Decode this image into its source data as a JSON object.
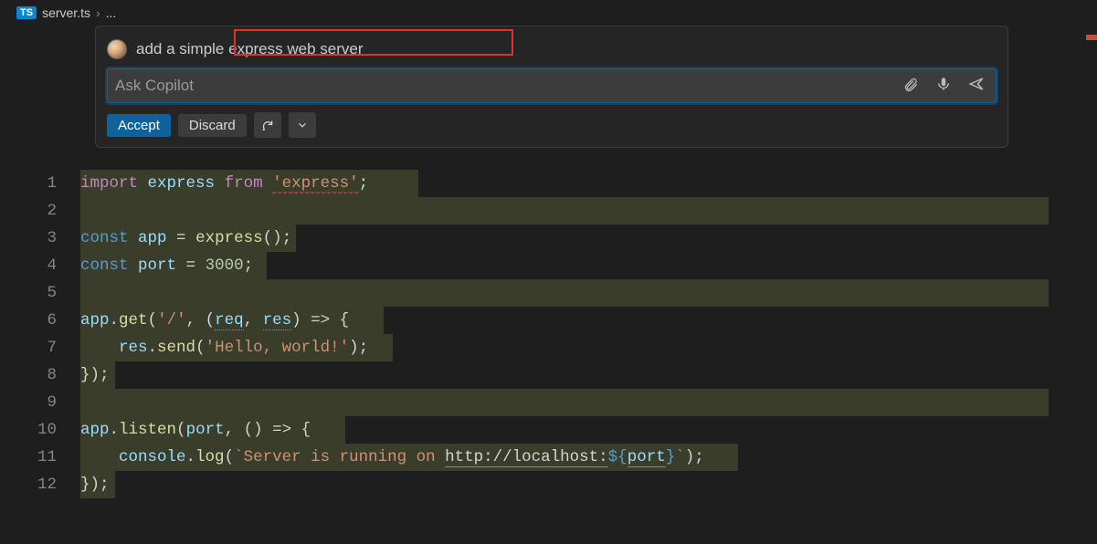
{
  "breadcrumb": {
    "badge": "TS",
    "filename": "server.ts",
    "ellipsis": "..."
  },
  "chat": {
    "prompt": "add a simple express web server",
    "placeholder": "Ask Copilot",
    "accept": "Accept",
    "discard": "Discard"
  },
  "gutter": [
    "1",
    "2",
    "3",
    "4",
    "5",
    "6",
    "7",
    "8",
    "9",
    "10",
    "11",
    "12"
  ],
  "code": {
    "l1": {
      "kw_import": "import",
      "var_express": "express",
      "kw_from": "from",
      "str_module": "'express'",
      "semi": ";"
    },
    "l3": {
      "kw_const": "const",
      "var_app": "app",
      "eq": " = ",
      "fn_express": "express",
      "tail": "();"
    },
    "l4": {
      "kw_const": "const",
      "var_port": "port",
      "eq": " = ",
      "num": "3000",
      "semi": ";"
    },
    "l6": {
      "var_app": "app",
      "dot": ".",
      "fn_get": "get",
      "open": "(",
      "str_path": "'/'",
      "comma": ", (",
      "p_req": "req",
      "c2": ", ",
      "p_res": "res",
      "arrow": ") => {"
    },
    "l7": {
      "indent": "    ",
      "var_res": "res",
      "dot": ".",
      "fn_send": "send",
      "open": "(",
      "str_hello": "'Hello, world!'",
      "close": ");"
    },
    "l8": {
      "close": "});"
    },
    "l10": {
      "var_app": "app",
      "dot": ".",
      "fn_listen": "listen",
      "open": "(",
      "var_port": "port",
      "arrow": ", () => {"
    },
    "l11": {
      "indent": "    ",
      "var_console": "console",
      "dot": ".",
      "fn_log": "log",
      "open": "(",
      "tick": "`",
      "txt1": "Server is running on ",
      "url": "http://localhost:",
      "interp_open": "${",
      "var_port": "port",
      "interp_close": "}",
      "tick2": "`",
      "close": ");"
    },
    "l12": {
      "close": "});"
    }
  }
}
